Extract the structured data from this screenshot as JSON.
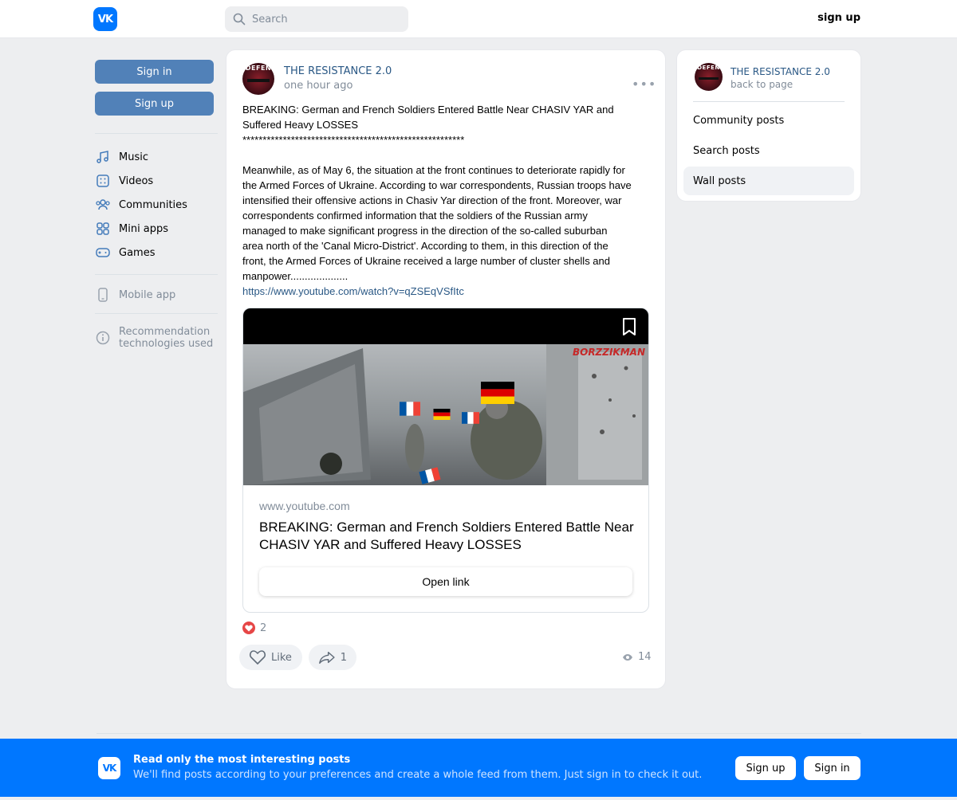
{
  "header": {
    "logo_text": "VK",
    "search_placeholder": "Search",
    "signup": "sign up"
  },
  "sidebar": {
    "signin_button": "Sign in",
    "signup_button": "Sign up",
    "items": [
      {
        "label": "Music",
        "icon": "music-icon"
      },
      {
        "label": "Videos",
        "icon": "videos-icon"
      },
      {
        "label": "Communities",
        "icon": "communities-icon"
      },
      {
        "label": "Mini apps",
        "icon": "mini-apps-icon"
      },
      {
        "label": "Games",
        "icon": "games-icon"
      }
    ],
    "mobile_app": "Mobile app",
    "recommendation_line1": "Recommendation",
    "recommendation_line2": "technologies used"
  },
  "post": {
    "author": "THE RESISTANCE 2.0",
    "time": "one hour ago",
    "avatar_text": "DEFEN",
    "text": "BREAKING: German and French Soldiers Entered Battle Near CHASIV YAR and\nSuffered Heavy LOSSES\n*******************************************************\n\nMeanwhile, as of May 6, the situation at the front continues to deteriorate rapidly for\nthe Armed Forces of Ukraine. According to war correspondents, Russian troops have\nintensified their offensive actions in Chasiv Yar direction of the front. Moreover, war\ncorrespondents confirmed information that the soldiers of the Russian army\nmanaged to make significant progress in the direction of the so-called suburban\narea north of the 'Canal Micro-District'. According to them, in this direction of the\nfront, the Armed Forces of Ukraine received a large number of cluster shells and\nmanpower....................",
    "link": "https://www.youtube.com/watch?v=qZSEqVSfItc",
    "link_card": {
      "watermark": "BORZZIKMAN",
      "domain": "www.youtube.com",
      "title": "BREAKING: German and French Soldiers Entered Battle Near CHASIV YAR and Suffered Heavy LOSSES",
      "open_link": "Open link"
    },
    "reactions_count": "2",
    "like_label": "Like",
    "share_count": "1",
    "views": "14"
  },
  "right": {
    "name": "THE RESISTANCE 2.0",
    "back": "back to page",
    "items": [
      {
        "label": "Community posts",
        "active": false
      },
      {
        "label": "Search posts",
        "active": false
      },
      {
        "label": "Wall posts",
        "active": true
      }
    ]
  },
  "banner": {
    "title": "Read only the most interesting posts",
    "subtitle": "We'll find posts according to your preferences and create a whole feed from them. Just sign in to check it out.",
    "signup": "Sign up",
    "signin": "Sign in"
  },
  "colors": {
    "brand": "#0077ff",
    "button": "#5181b8",
    "link": "#2a5885",
    "muted": "#818c99",
    "background": "#edeef0"
  }
}
